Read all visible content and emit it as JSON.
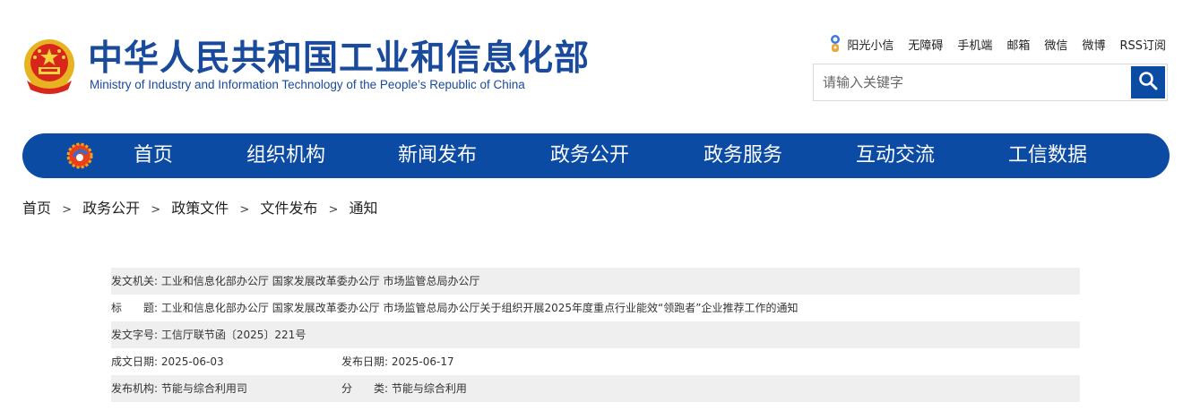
{
  "header": {
    "title": "中华人民共和国工业和信息化部",
    "subtitle": "Ministry of Industry and Information Technology of the People’s Republic of China"
  },
  "top_links": [
    "阳光小信",
    "无障碍",
    "手机端",
    "邮箱",
    "微信",
    "微博",
    "RSS订阅"
  ],
  "search": {
    "placeholder": "请输入关键字"
  },
  "nav": [
    "首页",
    "组织机构",
    "新闻发布",
    "政务公开",
    "政务服务",
    "互动交流",
    "工信数据"
  ],
  "breadcrumb": [
    "首页",
    "政务公开",
    "政策文件",
    "文件发布",
    "通知"
  ],
  "breadcrumb_sep": ">",
  "doc_info": {
    "issuer_label": "发文机关:",
    "issuer": "工业和信息化部办公厅 国家发展改革委办公厅 市场监管总局办公厅",
    "title_label": "标　　题:",
    "title": "工业和信息化部办公厅 国家发展改革委办公厅 市场监管总局办公厅关于组织开展2025年度重点行业能效“领跑者”企业推荐工作的通知",
    "doc_no_label": "发文字号:",
    "doc_no": "工信厅联节函〔2025〕221号",
    "written_date_label": "成文日期:",
    "written_date": "2025-06-03",
    "publish_date_label": "发布日期:",
    "publish_date": "2025-06-17",
    "publisher_label": "发布机构:",
    "publisher": "节能与综合利用司",
    "category_label": "分　　类:",
    "category": "节能与综合利用"
  },
  "colors": {
    "brand_blue": "#0b4ba4",
    "title_blue": "#1a4a9b",
    "row_shade": "#efefef"
  }
}
